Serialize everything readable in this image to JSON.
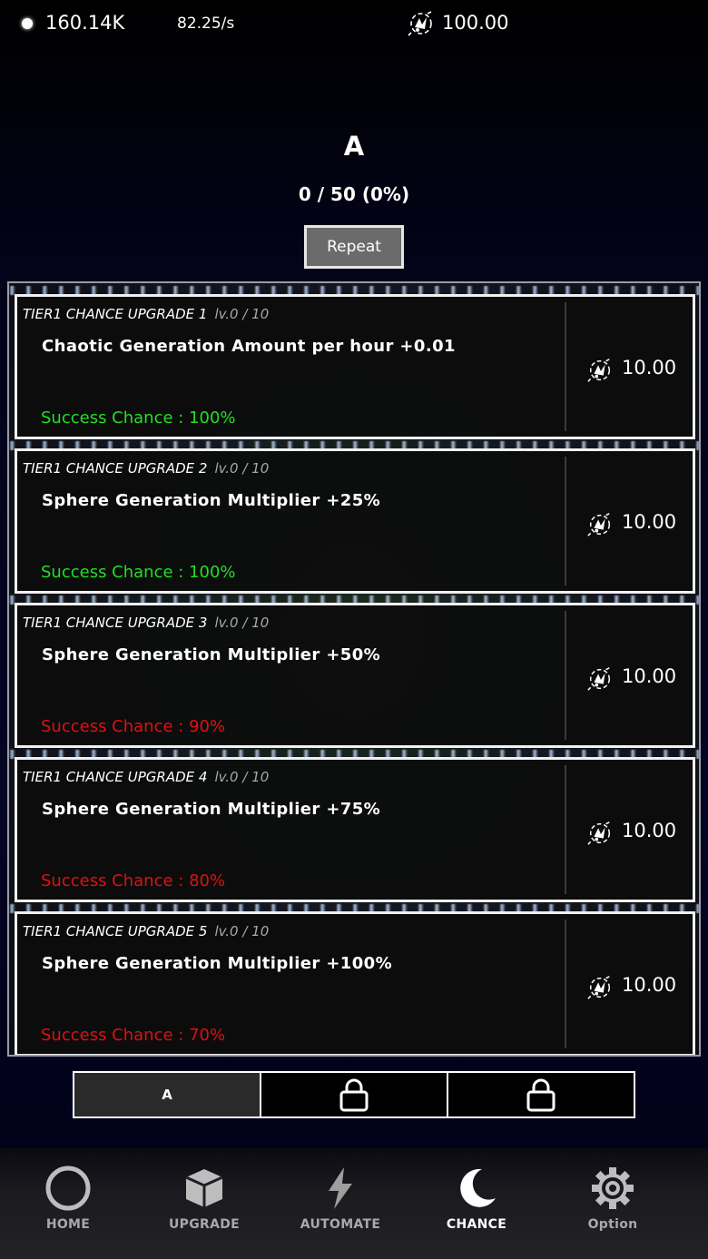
{
  "topbar": {
    "spheres": "160.14K",
    "rate": "82.25/s",
    "chaos_icon": "chaos-emblem-icon",
    "chaos": "100.00"
  },
  "header": {
    "title": "A",
    "progress": "0 / 50 (0%)",
    "repeat_label": "Repeat"
  },
  "upgrades": [
    {
      "tier": "TIER1 CHANCE UPGRADE 1",
      "level": "lv.0 / 10",
      "desc": "Chaotic Generation Amount per hour +0.01",
      "chance": "Success Chance : 100%",
      "chance_color": "#21e021",
      "cost": "10.00"
    },
    {
      "tier": "TIER1 CHANCE UPGRADE 2",
      "level": "lv.0 / 10",
      "desc": "Sphere Generation Multiplier +25%",
      "chance": "Success Chance : 100%",
      "chance_color": "#21e021",
      "cost": "10.00"
    },
    {
      "tier": "TIER1 CHANCE UPGRADE 3",
      "level": "lv.0 / 10",
      "desc": "Sphere Generation Multiplier +50%",
      "chance": "Success Chance : 90%",
      "chance_color": "#e01010",
      "cost": "10.00"
    },
    {
      "tier": "TIER1 CHANCE UPGRADE 4",
      "level": "lv.0 / 10",
      "desc": "Sphere Generation Multiplier +75%",
      "chance": "Success Chance : 80%",
      "chance_color": "#e01010",
      "cost": "10.00"
    },
    {
      "tier": "TIER1 CHANCE UPGRADE 5",
      "level": "lv.0 / 10",
      "desc": "Sphere Generation Multiplier +100%",
      "chance": "Success Chance : 70%",
      "chance_color": "#e01010",
      "cost": "10.00"
    }
  ],
  "subtabs": {
    "a_label": "A",
    "lock_icon": "lock-icon"
  },
  "nav": {
    "home": "HOME",
    "upgrade": "UPGRADE",
    "automate": "AUTOMATE",
    "chance": "CHANCE",
    "option": "Option",
    "active": "chance"
  }
}
